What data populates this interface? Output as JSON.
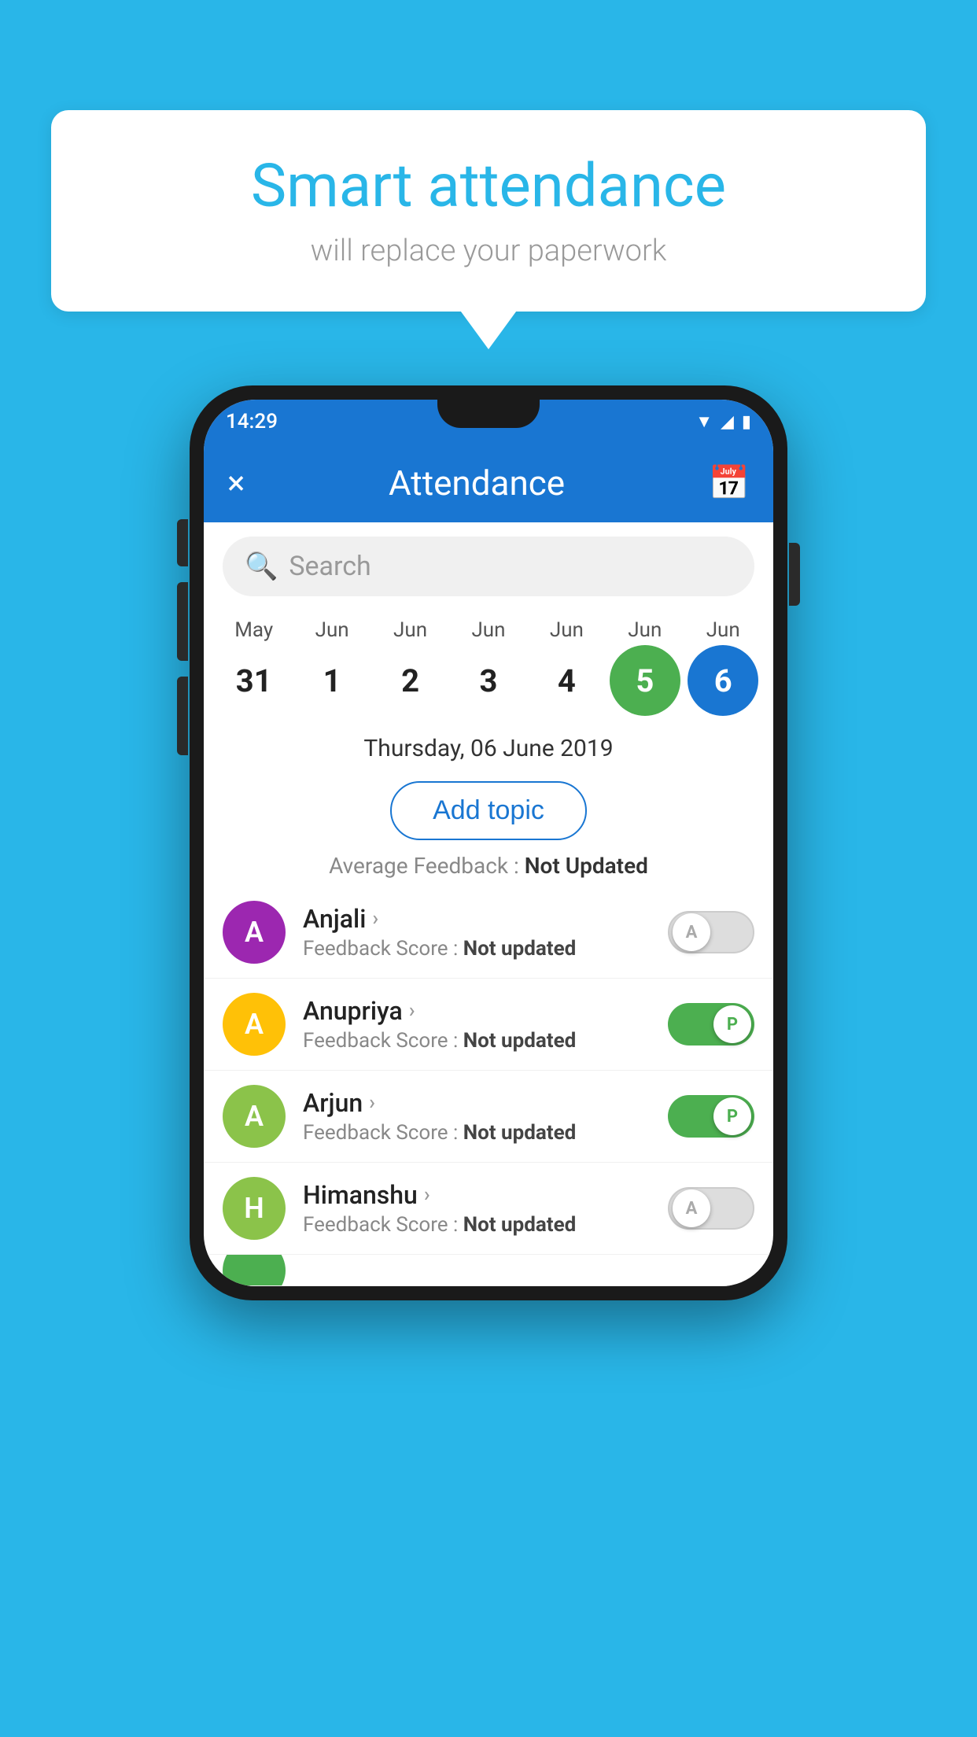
{
  "background_color": "#29b6e8",
  "speech_bubble": {
    "title": "Smart attendance",
    "subtitle": "will replace your paperwork"
  },
  "phone": {
    "status_bar": {
      "time": "14:29",
      "icons": [
        "wifi",
        "signal",
        "battery"
      ]
    },
    "app_bar": {
      "close_label": "×",
      "title": "Attendance",
      "calendar_icon": "📅"
    },
    "search": {
      "placeholder": "Search"
    },
    "calendar": {
      "months": [
        "May",
        "Jun",
        "Jun",
        "Jun",
        "Jun",
        "Jun",
        "Jun"
      ],
      "dates": [
        "31",
        "1",
        "2",
        "3",
        "4",
        "5",
        "6"
      ],
      "highlights": [
        {
          "date": "5",
          "style": "green"
        },
        {
          "date": "6",
          "style": "blue"
        }
      ]
    },
    "selected_date": "Thursday, 06 June 2019",
    "add_topic_label": "Add topic",
    "avg_feedback": {
      "label": "Average Feedback : ",
      "value": "Not Updated"
    },
    "students": [
      {
        "name": "Anjali",
        "avatar_letter": "A",
        "avatar_color": "#9c27b0",
        "feedback": "Feedback Score : Not updated",
        "toggle": "off",
        "toggle_label": "A"
      },
      {
        "name": "Anupriya",
        "avatar_letter": "A",
        "avatar_color": "#ffc107",
        "feedback": "Feedback Score : Not updated",
        "toggle": "on",
        "toggle_label": "P"
      },
      {
        "name": "Arjun",
        "avatar_letter": "A",
        "avatar_color": "#8bc34a",
        "feedback": "Feedback Score : Not updated",
        "toggle": "on",
        "toggle_label": "P"
      },
      {
        "name": "Himanshu",
        "avatar_letter": "H",
        "avatar_color": "#8bc34a",
        "feedback": "Feedback Score : Not updated",
        "toggle": "off",
        "toggle_label": "A"
      }
    ]
  }
}
